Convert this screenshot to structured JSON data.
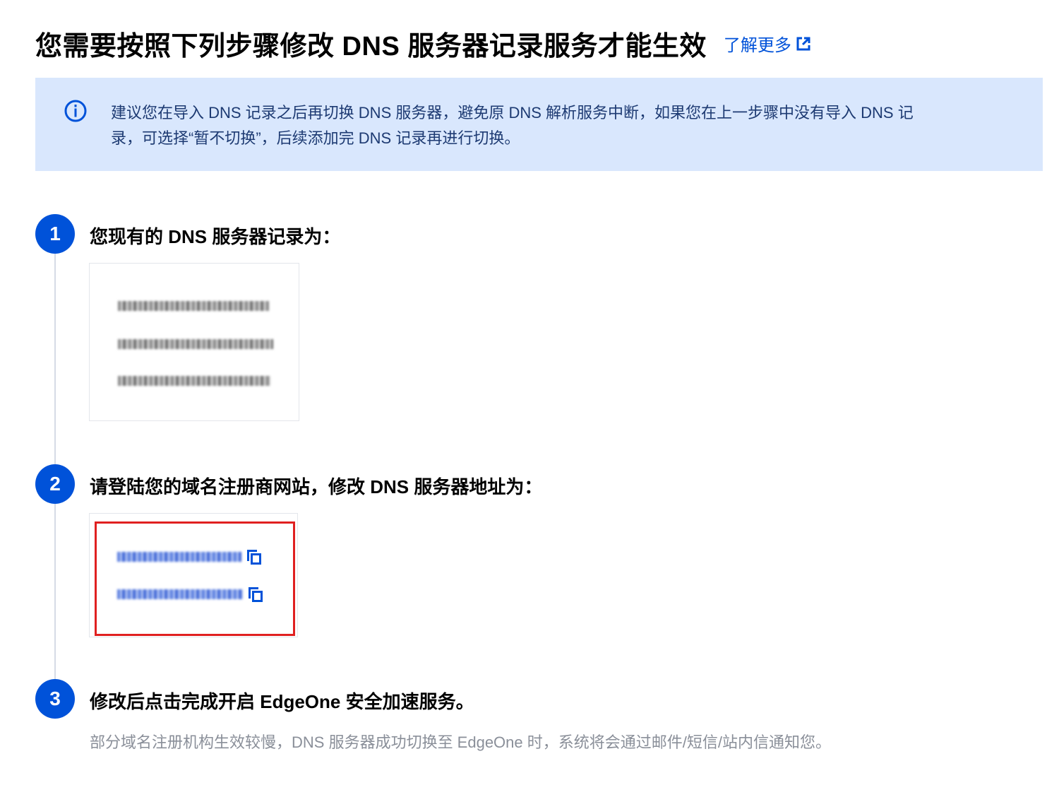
{
  "header": {
    "title": "您需要按照下列步骤修改 DNS 服务器记录服务才能生效",
    "learn_more_label": "了解更多"
  },
  "notice": {
    "line1": "建议您在导入 DNS 记录之后再切换 DNS 服务器，避免原 DNS 解析服务中断，如果您在上一步骤中没有导入 DNS 记",
    "line2": "录，可选择“暂不切换”，后续添加完 DNS 记录再进行切换。"
  },
  "steps": [
    {
      "number": "1",
      "title": "您现有的 DNS 服务器记录为："
    },
    {
      "number": "2",
      "title": "请登陆您的域名注册商网站，修改 DNS 服务器地址为："
    },
    {
      "number": "3",
      "title": "修改后点击完成开启 EdgeOne 安全加速服务。",
      "description": "部分域名注册机构生效较慢，DNS 服务器成功切换至 EdgeOne 时，系统将会通过邮件/短信/站内信通知您。"
    }
  ],
  "colors": {
    "accent": "#0052d9",
    "notice_bg": "#d9e7fd",
    "highlight_border": "#e02020"
  },
  "icons": {
    "info": "info-circle-icon",
    "external_link": "external-link-icon",
    "copy": "copy-icon"
  }
}
